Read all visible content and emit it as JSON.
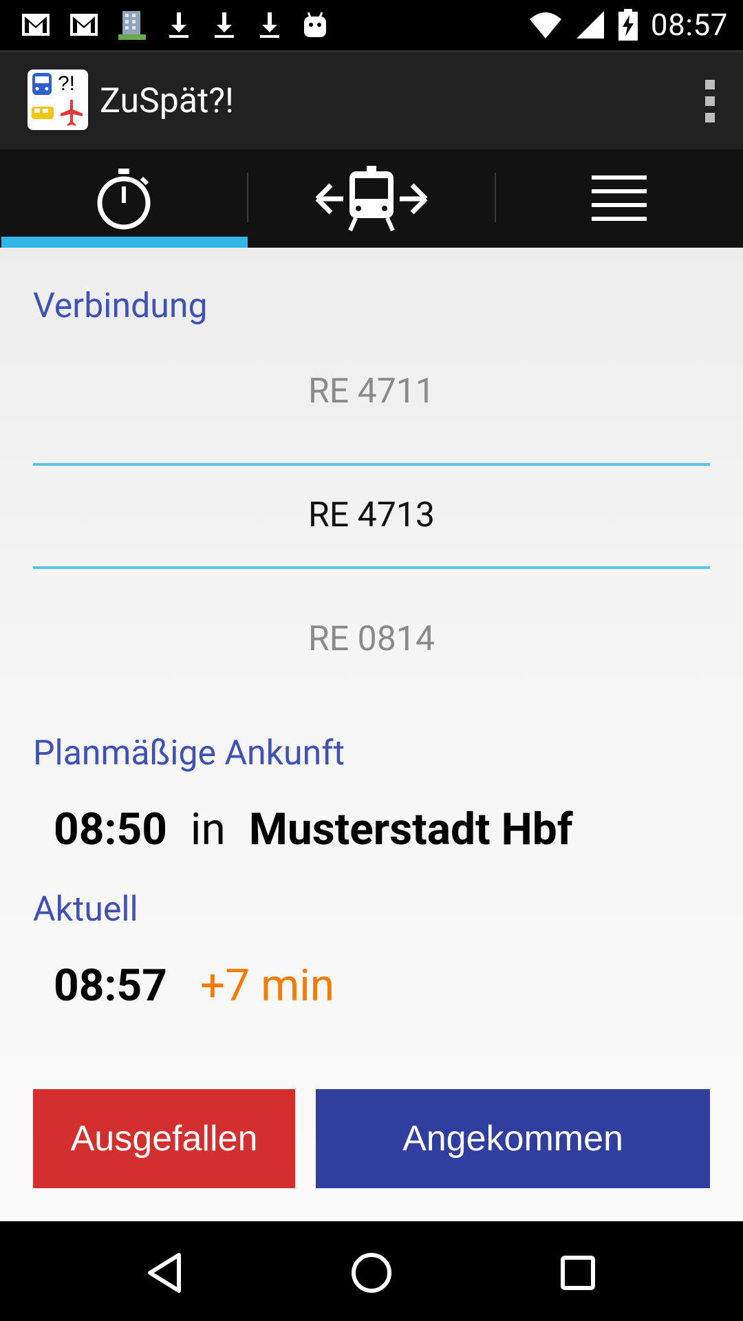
{
  "status_bar": {
    "time": "08:57",
    "left_icons": [
      "gmail-icon",
      "gmail-icon",
      "building-icon",
      "download-icon",
      "download-icon",
      "download-icon",
      "android-icon"
    ],
    "right_icons": [
      "wifi-icon",
      "cell-signal-icon",
      "battery-charging-icon"
    ]
  },
  "action_bar": {
    "title": "ZuSpät?!",
    "logo_text": "?!"
  },
  "tabs": [
    {
      "name": "timer",
      "icon": "stopwatch-icon",
      "selected": true
    },
    {
      "name": "connection",
      "icon": "train-arrows-icon",
      "selected": false
    },
    {
      "name": "list",
      "icon": "menu-lines-icon",
      "selected": false
    }
  ],
  "colors": {
    "accent": "#33b5e5",
    "label": "#3f51b5",
    "delay": "#f57c00",
    "cancel_button": "#d32f2f",
    "arrived_button": "#303f9f"
  },
  "main": {
    "connection_label": "Verbindung",
    "picker": {
      "previous": "RE 4711",
      "selected": "RE 4713",
      "next": "RE 0814"
    },
    "scheduled_label": "Planmäßige Ankunft",
    "scheduled_time": "08:50",
    "in_word": "in",
    "station": "Musterstadt Hbf",
    "current_label": "Aktuell",
    "current_time": "08:57",
    "delay": "+7 min"
  },
  "buttons": {
    "cancelled": "Ausgefallen",
    "arrived": "Angekommen"
  },
  "nav": [
    "back-icon",
    "home-icon",
    "recents-icon"
  ]
}
